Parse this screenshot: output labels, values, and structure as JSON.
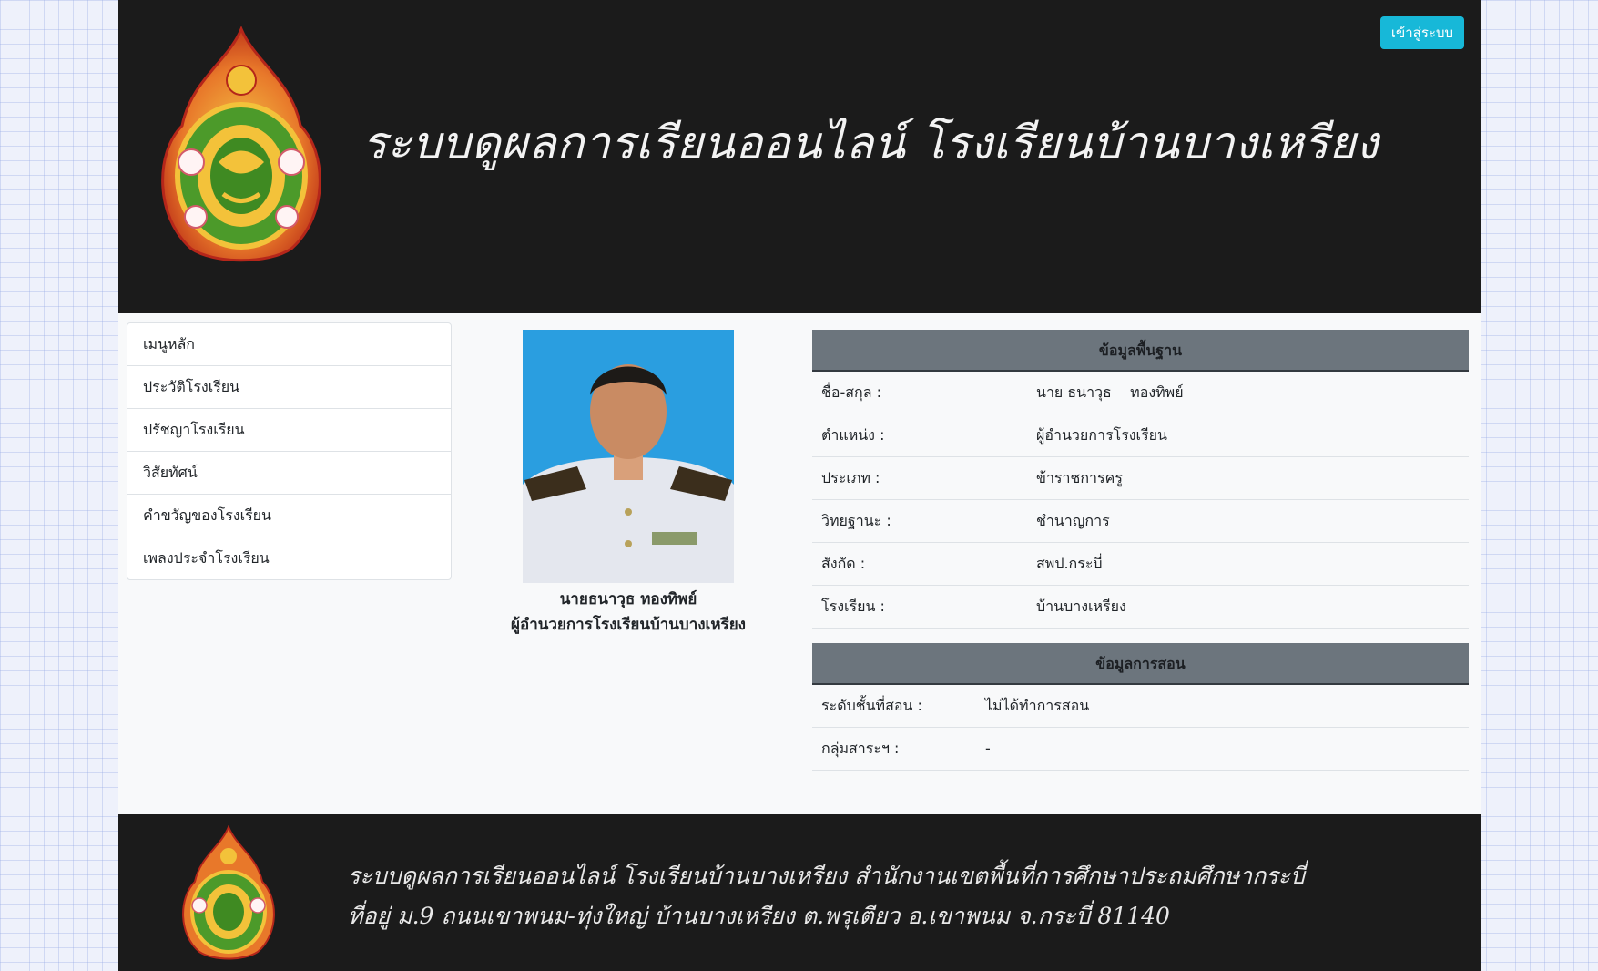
{
  "header": {
    "title": "ระบบดูผลการเรียนออนไลน์ โรงเรียนบ้านบางเหรียง",
    "login_label": "เข้าสู่ระบบ"
  },
  "sidebar": {
    "items": [
      {
        "label": "เมนูหลัก"
      },
      {
        "label": "ประวัติโรงเรียน"
      },
      {
        "label": "ปรัชญาโรงเรียน"
      },
      {
        "label": "วิสัยทัศน์"
      },
      {
        "label": "คำขวัญของโรงเรียน"
      },
      {
        "label": "เพลงประจำโรงเรียน"
      }
    ]
  },
  "profile": {
    "name": "นายธนาวุธ ทองทิพย์",
    "position": "ผู้อำนวยการโรงเรียนบ้านบางเหรียง"
  },
  "basic_info": {
    "heading": "ข้อมูลพื้นฐาน",
    "rows": [
      {
        "label": "ชื่อ-สกุล :",
        "value": "นาย ธนาวุธ    ทองทิพย์"
      },
      {
        "label": "ตำแหน่ง :",
        "value": "ผู้อำนวยการโรงเรียน"
      },
      {
        "label": "ประเภท :",
        "value": "ข้าราชการครู"
      },
      {
        "label": "วิทยฐานะ :",
        "value": "ชำนาญการ"
      },
      {
        "label": "สังกัด :",
        "value": "สพป.กระบี่"
      },
      {
        "label": "โรงเรียน :",
        "value": "บ้านบางเหรียง"
      }
    ]
  },
  "teaching_info": {
    "heading": "ข้อมูลการสอน",
    "rows": [
      {
        "label": "ระดับชั้นที่สอน :",
        "value": "ไม่ได้ทำการสอน"
      },
      {
        "label": "กลุ่มสาระฯ :",
        "value": "-"
      }
    ]
  },
  "footer": {
    "line1": "ระบบดูผลการเรียนออนไลน์ โรงเรียนบ้านบางเหรียง  สำนักงานเขตพื้นที่การศึกษาประถมศึกษากระบี่",
    "line2": "ที่อยู่ ม.9 ถนนเขาพนม-ทุ่งใหญ่  บ้านบางเหรียง  ต.พรุเตียว  อ.เขาพนม จ.กระบี่  81140"
  },
  "colors": {
    "header_bg": "#1b1b1b",
    "login_button": "#17b8d8",
    "section_header": "#6c757d"
  }
}
